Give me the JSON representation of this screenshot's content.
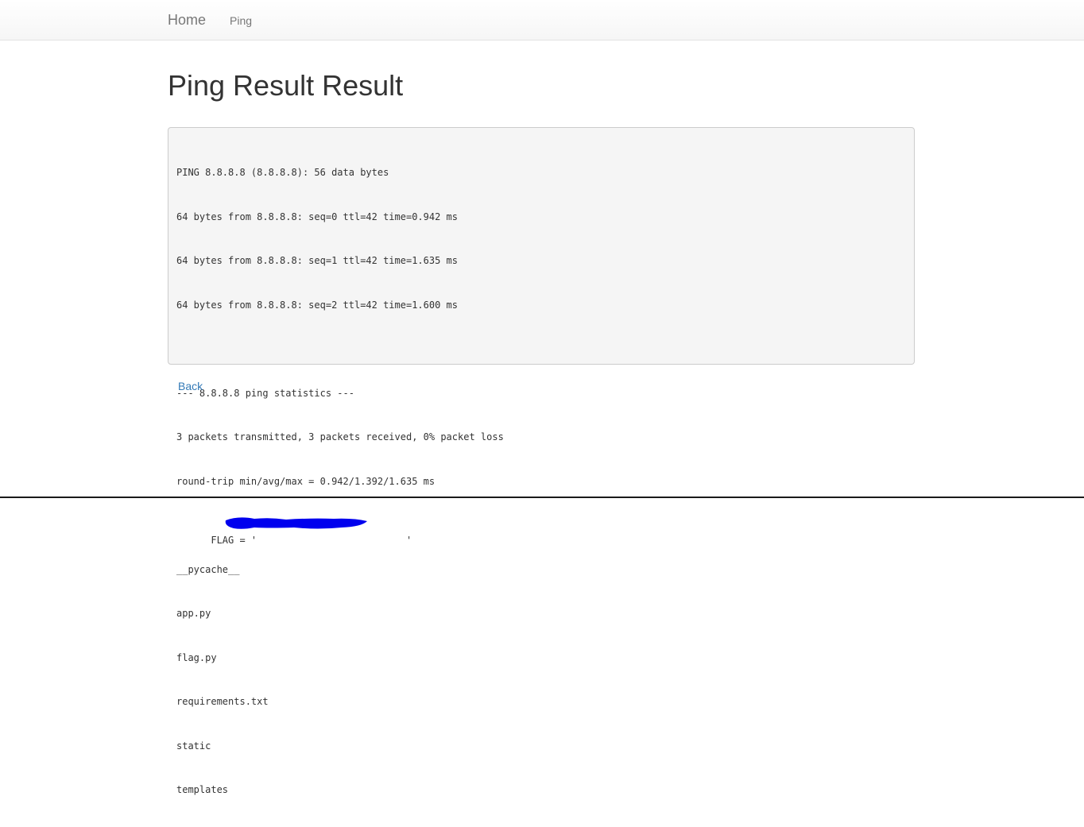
{
  "navbar": {
    "brand": "Home",
    "links": [
      {
        "label": "Ping"
      }
    ]
  },
  "page": {
    "title": "Ping Result Result"
  },
  "output": {
    "lines": [
      "PING 8.8.8.8 (8.8.8.8): 56 data bytes",
      "64 bytes from 8.8.8.8: seq=0 ttl=42 time=0.942 ms",
      "64 bytes from 8.8.8.8: seq=1 ttl=42 time=1.635 ms",
      "64 bytes from 8.8.8.8: seq=2 ttl=42 time=1.600 ms",
      "",
      "--- 8.8.8.8 ping statistics ---",
      "3 packets transmitted, 3 packets received, 0% packet loss",
      "round-trip min/avg/max = 0.942/1.392/1.635 ms",
      "FLAG = '                          '",
      "__pycache__",
      "app.py",
      "flag.py",
      "requirements.txt",
      "static",
      "templates"
    ],
    "redaction_color": "#0000ee"
  },
  "actions": {
    "back_label": "Back"
  }
}
